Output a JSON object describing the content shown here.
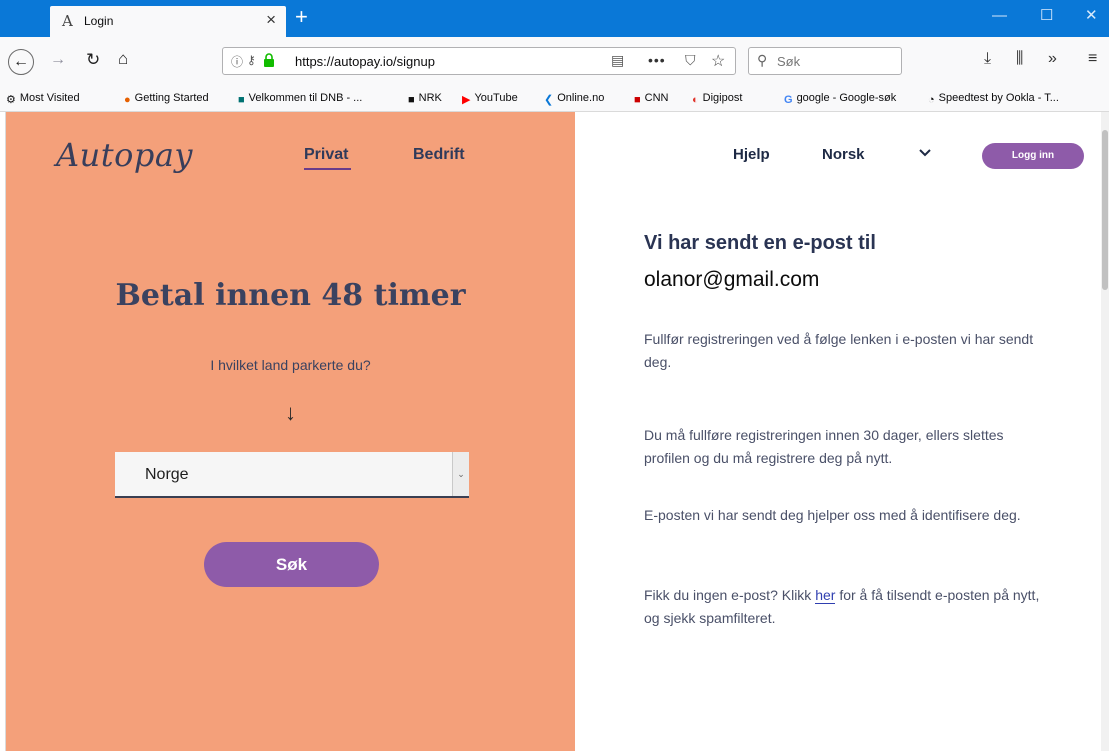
{
  "browser": {
    "tab_title": "Login",
    "new_tab": "+",
    "url": "https://autopay.io/signup",
    "search_placeholder": "Søk",
    "bookmarks": [
      "Most Visited",
      "Getting Started",
      "Velkommen til DNB - ...",
      "NRK",
      "YouTube",
      "Online.no",
      "CNN",
      "Digipost",
      "google - Google-søk",
      "Speedtest by Ookla - T..."
    ]
  },
  "header": {
    "logo": "Autopay",
    "nav_privat": "Privat",
    "nav_bedrift": "Bedrift",
    "help": "Hjelp",
    "language": "Norsk",
    "login_button": "Logg inn"
  },
  "left": {
    "headline": "Betal innen 48 timer",
    "question": "I hvilket land parkerte du?",
    "arrow": "↓",
    "country_selected": "Norge",
    "search_button": "Søk"
  },
  "right": {
    "title": "Vi har sendt en e-post til",
    "email": "olanor@gmail.com",
    "p1": "Fullfør registreringen ved å følge lenken i e-posten vi har sendt deg.",
    "p2": "Du må fullføre registreringen innen 30 dager, ellers slettes profilen og du må registrere deg på nytt.",
    "p3": "E-posten vi har sendt deg hjelper oss med å identifisere deg.",
    "p4_before": "Fikk du ingen e-post? Klikk ",
    "p4_link": "her",
    "p4_after": " for å få tilsendt e-posten på nytt, og sjekk spamfilteret."
  },
  "colors": {
    "left_bg": "#f4a07a",
    "accent_purple": "#8e5ba9",
    "titlebar_blue": "#0a78d7"
  }
}
